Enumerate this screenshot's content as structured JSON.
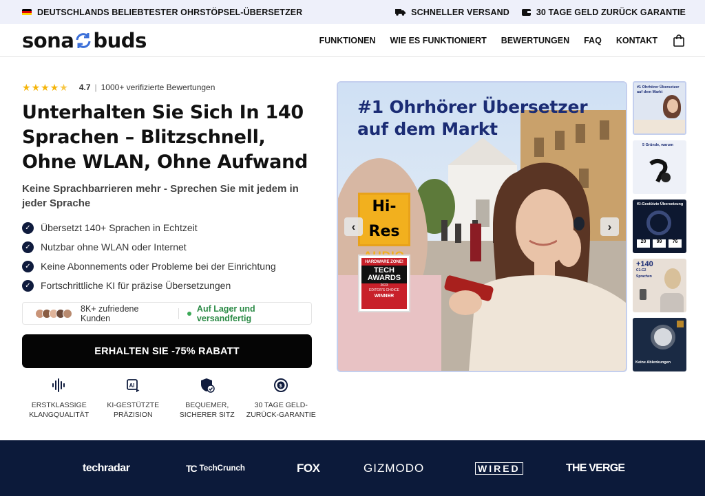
{
  "topbar": {
    "left_text": "DEUTSCHLANDS BELIEBTESTER OHRSTÖPSEL-ÜBERSETZER",
    "shipping": "SCHNELLER VERSAND",
    "guarantee": "30 TAGE GELD ZURÜCK GARANTIE"
  },
  "header": {
    "logo_left": "sona",
    "logo_right": "buds",
    "nav": [
      "FUNKTIONEN",
      "WIE ES FUNKTIONIERT",
      "BEWERTUNGEN",
      "FAQ",
      "KONTAKT"
    ]
  },
  "product": {
    "rating": "4.7",
    "rating_sep": "|",
    "reviews": "1000+ verifizierte Bewertungen",
    "title": "Unterhalten Sie Sich In 140 Sprachen – Blitzschnell, Ohne WLAN, Ohne Aufwand",
    "subtitle": "Keine Sprachbarrieren mehr - Sprechen Sie mit jedem in jeder Sprache",
    "features": [
      "Übersetzt 140+ Sprachen in Echtzeit",
      "Nutzbar ohne WLAN oder Internet",
      "Keine Abonnements oder Probleme bei der Einrichtung",
      "Fortschrittliche KI für präzise Übersetzungen"
    ],
    "customers": "8K+ zufriedene Kunden",
    "stock": "Auf Lager und versandfertig",
    "cta": "ERHALTEN SIE -75% RABATT",
    "usps": [
      {
        "line1": "ERSTKLASSIGE",
        "line2": "KLANGQUALITÄT",
        "icon": "soundwave-icon"
      },
      {
        "line1": "KI-GESTÜTZTE",
        "line2": "PRÄZISION",
        "icon": "ai-icon"
      },
      {
        "line1": "BEQUEMER,",
        "line2": "SICHERER SITZ",
        "icon": "shield-check-icon"
      },
      {
        "line1": "30 TAGE GELD-",
        "line2": "ZURÜCK-GARANTIE",
        "icon": "money-back-icon"
      }
    ]
  },
  "hero": {
    "headline_line1": "#1 Ohrhörer Übersetzer",
    "headline_line2": "auf dem Markt",
    "badge1_top": "Hi-Res",
    "badge1_bottom": "AUDIO",
    "badge2_top": "HARDWARE ZONE!",
    "badge2_mid1": "TECH",
    "badge2_mid2": "AWARDS",
    "badge2_year": "2023",
    "badge2_choice": "EDITOR'S CHOICE",
    "badge2_winner": "WINNER"
  },
  "thumbs": {
    "t1_l1": "#1 Ohrhörer Übersetzer",
    "t1_l2": "auf dem Markt",
    "t2": "5 Gründe, warum",
    "t3": "KI-Gestützte Übersetzung",
    "t3_s1": "20",
    "t3_s2": "99",
    "t3_s3": "76",
    "t4_l1": "+140",
    "t4_l2": "C1-C2",
    "t4_l3": "Sprachen",
    "t5": "Keine Ablenkungen"
  },
  "press": [
    "techradar",
    "TechCrunch",
    "FOX",
    "GIZMODO",
    "WIRED",
    "THE VERGE"
  ],
  "colors": {
    "topbar_bg": "#eef0fa",
    "navy": "#0c1a3a",
    "star": "#f5b50a",
    "stock_green": "#2a8a45",
    "hero_headline": "#1b2c74"
  }
}
